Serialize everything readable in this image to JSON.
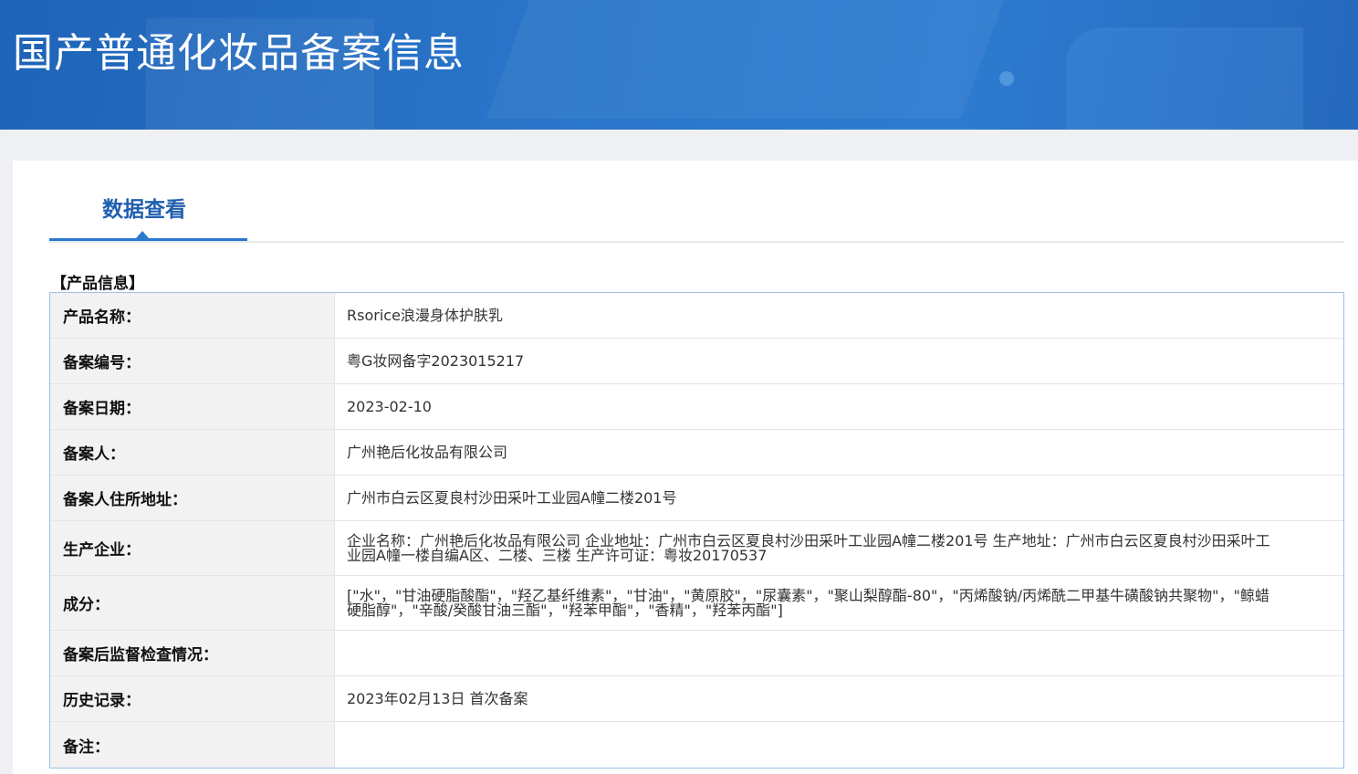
{
  "banner": {
    "title": "国产普通化妆品备案信息"
  },
  "tabs": [
    {
      "label": "数据查看",
      "active": true
    }
  ],
  "section": {
    "title": "【产品信息】"
  },
  "colors": {
    "banner_blue": "#2a75c9",
    "tab_text": "#1f5fae",
    "tab_underline": "#2a78d0",
    "table_border": "#9fc0e6",
    "label_bg": "#f2f2f2"
  },
  "rows": [
    {
      "label": "产品名称：",
      "value": "Rsorice浪漫身体护肤乳"
    },
    {
      "label": "备案编号：",
      "value": "粤G妆网备字2023015217"
    },
    {
      "label": "备案日期：",
      "value": "2023-02-10"
    },
    {
      "label": "备案人：",
      "value": "广州艳后化妆品有限公司"
    },
    {
      "label": "备案人住所地址：",
      "value": "广州市白云区夏良村沙田采叶工业园A幢二楼201号"
    },
    {
      "label": "生产企业：",
      "value": "企业名称：广州艳后化妆品有限公司 企业地址：广州市白云区夏良村沙田采叶工业园A幢二楼201号 生产地址：广州市白云区夏良村沙田采叶工业园A幢一楼自编A区、二楼、三楼 生产许可证：粤妆20170537"
    },
    {
      "label": "成分：",
      "value": "[\"水\"，\"甘油硬脂酸酯\"，\"羟乙基纤维素\"，\"甘油\"，\"黄原胶\"，\"尿囊素\"，\"聚山梨醇酯-80\"，\"丙烯酸钠/丙烯酰二甲基牛磺酸钠共聚物\"，\"鲸蜡硬脂醇\"，\"辛酸/癸酸甘油三酯\"，\"羟苯甲酯\"，\"香精\"，\"羟苯丙酯\"]"
    },
    {
      "label": "备案后监督检查情况：",
      "value": ""
    },
    {
      "label": "历史记录：",
      "value": "2023年02月13日 首次备案"
    },
    {
      "label": "备注：",
      "value": ""
    }
  ]
}
